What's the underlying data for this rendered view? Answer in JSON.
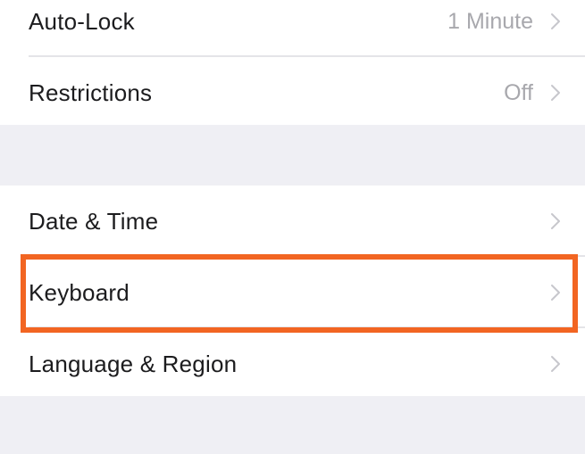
{
  "settings": {
    "group1": [
      {
        "label": "Auto-Lock",
        "value": "1 Minute",
        "icon": "chevron-right-icon"
      },
      {
        "label": "Restrictions",
        "value": "Off",
        "icon": "chevron-right-icon"
      }
    ],
    "group2": [
      {
        "label": "Date & Time",
        "value": "",
        "icon": "chevron-right-icon"
      },
      {
        "label": "Keyboard",
        "value": "",
        "icon": "chevron-right-icon",
        "highlighted": true
      },
      {
        "label": "Language & Region",
        "value": "",
        "icon": "chevron-right-icon"
      }
    ]
  },
  "colors": {
    "background": "#efeff4",
    "cell": "#ffffff",
    "label": "#1c1c1e",
    "secondary": "#a8a8ad",
    "highlight": "#f26522"
  }
}
